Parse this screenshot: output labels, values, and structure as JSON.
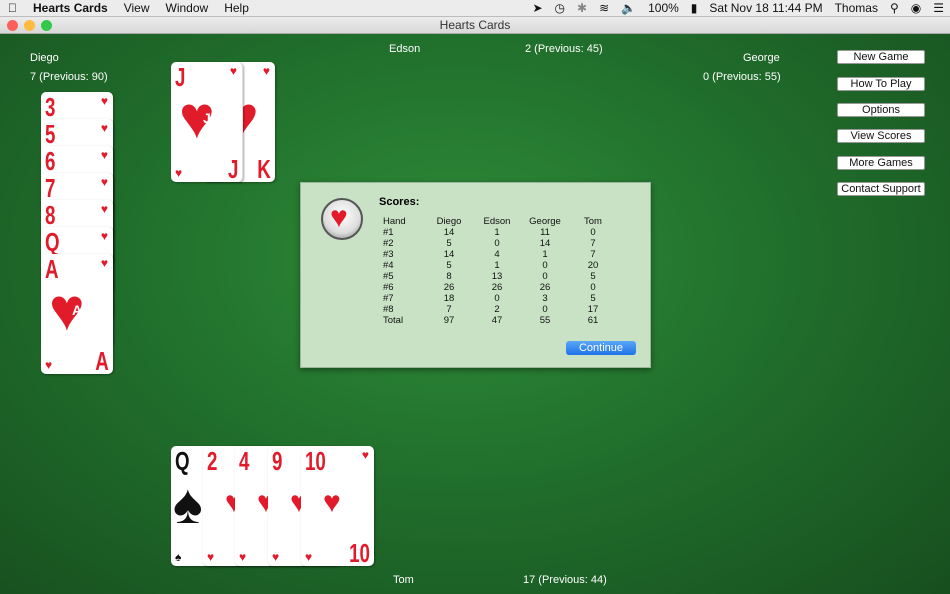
{
  "menubar": {
    "app_name": "Hearts Cards",
    "items": [
      "View",
      "Window",
      "Help"
    ],
    "battery": "100%",
    "datetime": "Sat Nov 18  11:44 PM",
    "user": "Thomas"
  },
  "window": {
    "title": "Hearts Cards"
  },
  "players": {
    "diego": {
      "name": "Diego",
      "score": "7 (Previous: 90)"
    },
    "edson": {
      "name": "Edson",
      "score": "2 (Previous: 45)"
    },
    "george": {
      "name": "George",
      "score": "0 (Previous: 55)"
    },
    "tom": {
      "name": "Tom",
      "score": "17 (Previous: 44)"
    }
  },
  "side_buttons": [
    "New Game",
    "How To Play",
    "Options",
    "View Scores",
    "More Games",
    "Contact Support"
  ],
  "diego_cards": [
    "3",
    "5",
    "6",
    "7",
    "8",
    "Q",
    "A"
  ],
  "edson_cards": [
    "J",
    "K"
  ],
  "tom_cards": [
    "Q",
    "2",
    "4",
    "9",
    "10"
  ],
  "dialog": {
    "heading": "Scores:",
    "columns": [
      "Hand",
      "Diego",
      "Edson",
      "George",
      "Tom"
    ],
    "rows": [
      [
        "#1",
        "14",
        "1",
        "11",
        "0"
      ],
      [
        "#2",
        "5",
        "0",
        "14",
        "7"
      ],
      [
        "#3",
        "14",
        "4",
        "1",
        "7"
      ],
      [
        "#4",
        "5",
        "1",
        "0",
        "20"
      ],
      [
        "#5",
        "8",
        "13",
        "0",
        "5"
      ],
      [
        "#6",
        "26",
        "26",
        "26",
        "0"
      ],
      [
        "#7",
        "18",
        "0",
        "3",
        "5"
      ],
      [
        "#8",
        "7",
        "2",
        "0",
        "17"
      ],
      [
        "Total",
        "97",
        "47",
        "55",
        "61"
      ]
    ],
    "continue_label": "Continue"
  }
}
